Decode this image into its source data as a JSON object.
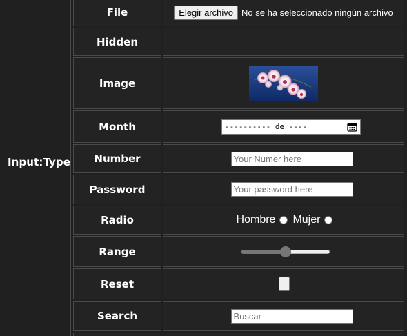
{
  "group_label": "Input:Type",
  "rows": [
    {
      "label": "File"
    },
    {
      "label": "Hidden"
    },
    {
      "label": "Image"
    },
    {
      "label": "Month"
    },
    {
      "label": "Number"
    },
    {
      "label": "Password"
    },
    {
      "label": "Radio"
    },
    {
      "label": "Range"
    },
    {
      "label": "Reset"
    },
    {
      "label": "Search"
    }
  ],
  "file": {
    "button_label": "Elegir archivo",
    "status_text": "No se ha seleccionado ningún archivo"
  },
  "month": {
    "display_value": "---------- de ----"
  },
  "number": {
    "placeholder": "Your Numer here"
  },
  "password": {
    "placeholder": "Your password here"
  },
  "radio": {
    "options": [
      {
        "label": "Hombre"
      },
      {
        "label": "Mujer"
      }
    ]
  },
  "range": {
    "value_fraction": 0.5
  },
  "search": {
    "placeholder": "Buscar"
  },
  "colors": {
    "background": "#202020",
    "cell_background": "#232323",
    "border": "#4a4a4a",
    "text": "#ffffff"
  },
  "icons": {
    "month": "calendar-icon",
    "image": "orchid-image"
  }
}
